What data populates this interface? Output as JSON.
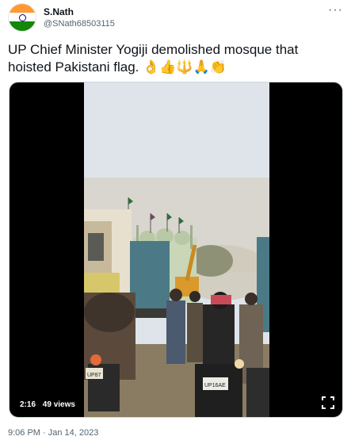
{
  "author": {
    "name": "S.Nath",
    "handle": "@SNath68503115",
    "avatar_icon": "india-flag-avatar-icon"
  },
  "tweet": {
    "text": "UP Chief Minister Yogiji demolished mosque that hoisted Pakistani flag. 👌👍🔱🙏👏",
    "more_icon": "more-options-icon"
  },
  "media": {
    "duration": "2:16",
    "views": "49 views",
    "fullscreen_icon": "fullscreen-icon",
    "plate_front": "UP87",
    "plate_back": "UP16AE"
  },
  "meta": {
    "timestamp": "9:06 PM · Jan 14, 2023"
  },
  "colors": {
    "text_primary": "#0f1419",
    "text_secondary": "#536471",
    "media_border": "#cfd9de"
  }
}
